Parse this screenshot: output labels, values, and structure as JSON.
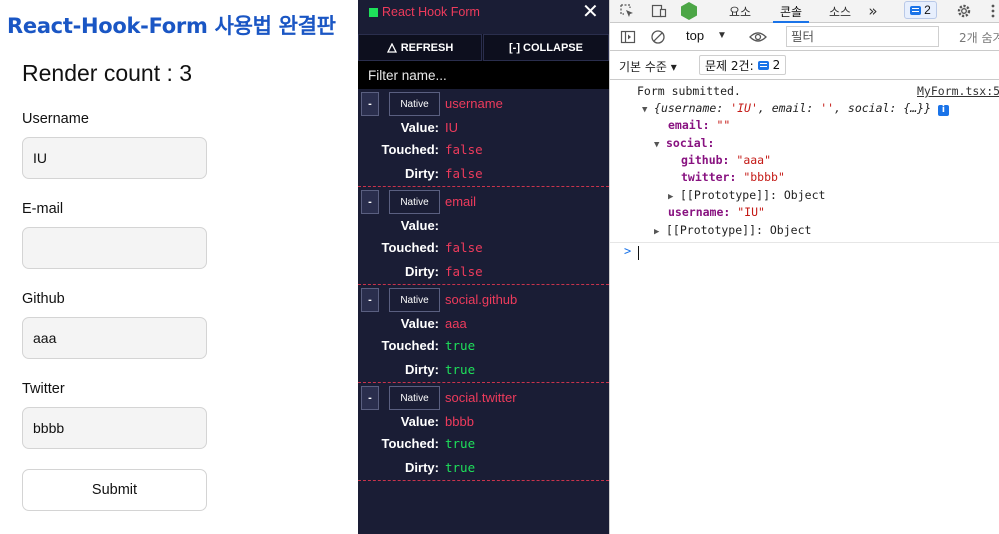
{
  "form": {
    "title": "React-Hook-Form 사용법 완결판",
    "render_count": "Render count : 3",
    "fields": [
      {
        "label": "Username",
        "value": "IU"
      },
      {
        "label": "E-mail",
        "value": ""
      },
      {
        "label": "Github",
        "value": "aaa"
      },
      {
        "label": "Twitter",
        "value": "bbbb"
      }
    ],
    "submit_label": "Submit"
  },
  "rhf_devtool": {
    "title": "React Hook Form",
    "close_glyph": "✕",
    "refresh_label": "REFRESH",
    "collapse_label": "[-] COLLAPSE",
    "filter_placeholder": "Filter name...",
    "minus_label": "-",
    "native_label": "Native",
    "key_value": "Value:",
    "key_touched": "Touched:",
    "key_dirty": "Dirty:",
    "fields": [
      {
        "name": "username",
        "value": "IU",
        "touched": "false",
        "dirty": "false"
      },
      {
        "name": "email",
        "value": "",
        "touched": "false",
        "dirty": "false"
      },
      {
        "name": "social.github",
        "value": "aaa",
        "touched": "true",
        "dirty": "true"
      },
      {
        "name": "social.twitter",
        "value": "bbbb",
        "touched": "true",
        "dirty": "true"
      }
    ],
    "colors": {
      "accent": "#ee3b5c",
      "true": "#1ee05a",
      "background": "#1a1d35"
    }
  },
  "chrome_devtools": {
    "tabs": [
      "요소",
      "콘솔",
      "소스"
    ],
    "active_tab": "콘솔",
    "more_tabs": "»",
    "issues_badge": "2",
    "context": "top",
    "filter_placeholder": "필터",
    "hidden_count": "2개 숨겨",
    "level_select": "기본 수준 ▾",
    "issues_label": "문제 2건:",
    "issues_count": "2",
    "console": {
      "message": "Form submitted.",
      "source": "MyForm.tsx:5",
      "object_preview": {
        "open": "{",
        "k_username": "username: ",
        "v_username": "'IU'",
        "k_email": ", email: ",
        "v_email": "''",
        "k_social": ", social: ",
        "v_social": "{…}",
        "close": "}"
      },
      "info_badge": "i",
      "email_key": "email",
      "email_value": "\"\"",
      "social_key": "social",
      "github_key": "github",
      "github_value": "\"aaa\"",
      "twitter_key": "twitter",
      "twitter_value": "\"bbbb\"",
      "prototype_label": "[[Prototype]]",
      "prototype_value": "Object",
      "username_key": "username",
      "username_value": "\"IU\"",
      "prompt": ">"
    }
  }
}
